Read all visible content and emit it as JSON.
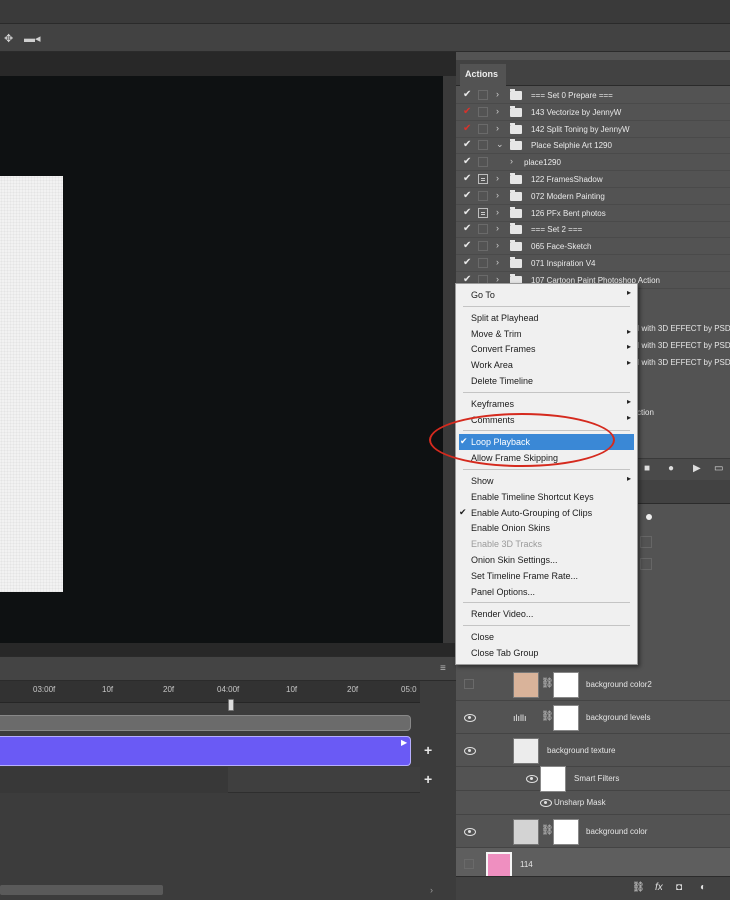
{
  "timeline": {
    "ticks": [
      "03:00f",
      "10f",
      "20f",
      "04:00f",
      "10f",
      "20f",
      "05:0"
    ]
  },
  "actions": {
    "tab": "Actions",
    "rows": [
      {
        "label": "=== Set 0 Prepare ===",
        "check": "white",
        "caret": "›",
        "folder": true,
        "dialog": false
      },
      {
        "label": "143 Vectorize by JennyW",
        "check": "red",
        "caret": "›",
        "folder": true,
        "dialog": false
      },
      {
        "label": "142 Split Toning by JennyW",
        "check": "red",
        "caret": "›",
        "folder": true,
        "dialog": false
      },
      {
        "label": "Place Selphie Art 1290",
        "check": "white",
        "caret": "⌄",
        "folder": true,
        "dialog": false
      },
      {
        "label": "place1290",
        "check": "white",
        "caret": "›",
        "folder": false,
        "dialog": false,
        "indent": true
      },
      {
        "label": "122 FramesShadow",
        "check": "white",
        "caret": "›",
        "folder": true,
        "dialog": true
      },
      {
        "label": "072 Modern Painting",
        "check": "white",
        "caret": "›",
        "folder": true,
        "dialog": false
      },
      {
        "label": "126 PFx Bent photos",
        "check": "white",
        "caret": "›",
        "folder": true,
        "dialog": true
      },
      {
        "label": "=== Set 2 ===",
        "check": "white",
        "caret": "›",
        "folder": true,
        "dialog": false
      },
      {
        "label": "065 Face-Sketch",
        "check": "white",
        "caret": "›",
        "folder": true,
        "dialog": false
      },
      {
        "label": "071 Inspiration V4",
        "check": "white",
        "caret": "›",
        "folder": true,
        "dialog": false
      },
      {
        "label": "107 Cartoon Paint Photoshop Action",
        "check": "white",
        "caret": "›",
        "folder": true,
        "dialog": false
      }
    ],
    "fragments": [
      "I with 3D EFFECT by PSD",
      "I with 3D EFFECT by PSD",
      "I with 3D EFFECT by PSD",
      "ction"
    ]
  },
  "context_menu": {
    "items": [
      {
        "label": "Go To",
        "submenu": true
      },
      {
        "sep": true
      },
      {
        "label": "Split at Playhead"
      },
      {
        "label": "Move & Trim",
        "submenu": true
      },
      {
        "label": "Convert Frames",
        "submenu": true
      },
      {
        "label": "Work Area",
        "submenu": true
      },
      {
        "label": "Delete Timeline"
      },
      {
        "sep": true
      },
      {
        "label": "Keyframes",
        "submenu": true
      },
      {
        "label": "Comments",
        "submenu": true
      },
      {
        "sep": true
      },
      {
        "label": "Loop Playback",
        "checked": true,
        "selected": true
      },
      {
        "label": "Allow Frame Skipping"
      },
      {
        "sep": true
      },
      {
        "label": "Show",
        "submenu": true
      },
      {
        "label": "Enable Timeline Shortcut Keys"
      },
      {
        "label": "Enable Auto-Grouping of Clips",
        "checked": true
      },
      {
        "label": "Enable Onion Skins"
      },
      {
        "label": "Enable 3D Tracks",
        "disabled": true
      },
      {
        "label": "Onion Skin Settings..."
      },
      {
        "label": "Set Timeline Frame Rate..."
      },
      {
        "label": "Panel Options..."
      },
      {
        "sep": true
      },
      {
        "label": "Render Video..."
      },
      {
        "sep": true
      },
      {
        "label": "Close"
      },
      {
        "label": "Close Tab Group"
      }
    ]
  },
  "layers": {
    "rows": [
      {
        "name": "background color2",
        "eye": false,
        "thumb": "tan",
        "mask": true
      },
      {
        "name": "background levels",
        "eye": true,
        "thumb": "levels",
        "mask": true
      },
      {
        "name": "background texture",
        "eye": true,
        "thumb": "texture",
        "mask": false
      },
      {
        "name": "Smart Filters",
        "eye": true,
        "thumb": "none",
        "mask": true,
        "sub": true
      },
      {
        "name": "Unsharp Mask",
        "eye": true,
        "thumb": "none",
        "mask": false,
        "subsub": true
      },
      {
        "name": "background color",
        "eye": true,
        "thumb": "gray",
        "mask": true
      },
      {
        "name": "114",
        "eye": false,
        "thumb": "pink",
        "mask": false
      }
    ],
    "bottom_icons": [
      "link-icon",
      "fx-icon",
      "mask-icon",
      "adjustment-icon"
    ],
    "bottom_glyphs": [
      "⛓",
      "fx",
      "◘",
      "◐"
    ]
  },
  "colors": {
    "accent_purple": "#6a5af5",
    "menu_highlight": "#3a88d6",
    "annotation_red": "#d52a1e",
    "swatch_tan": "#d9b39a",
    "swatch_pink": "#ef8fc0"
  }
}
